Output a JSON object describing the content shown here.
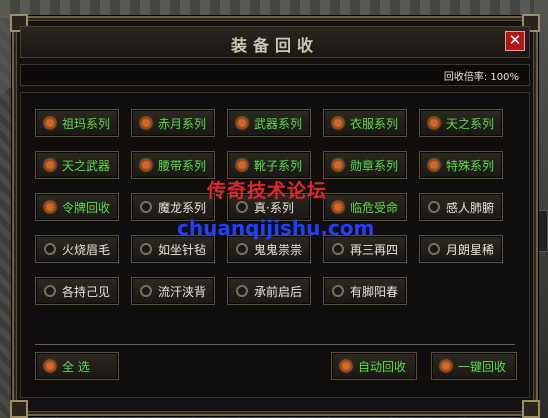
{
  "window": {
    "title": "装备回收",
    "rate_text": "回收倍率: 100%",
    "close_symbol": "✕"
  },
  "categories": [
    {
      "label": "祖玛系列",
      "checked": true
    },
    {
      "label": "赤月系列",
      "checked": true
    },
    {
      "label": "武器系列",
      "checked": true
    },
    {
      "label": "衣服系列",
      "checked": true
    },
    {
      "label": "天之系列",
      "checked": true
    },
    {
      "label": "天之武器",
      "checked": true
    },
    {
      "label": "腰带系列",
      "checked": true
    },
    {
      "label": "靴子系列",
      "checked": true
    },
    {
      "label": "勋章系列",
      "checked": true
    },
    {
      "label": "特殊系列",
      "checked": true
    },
    {
      "label": "令牌回收",
      "checked": true
    },
    {
      "label": "魔龙系列",
      "checked": false
    },
    {
      "label": "真·系列",
      "checked": false
    },
    {
      "label": "临危受命",
      "checked": true
    },
    {
      "label": "感人肺腑",
      "checked": false
    },
    {
      "label": "火烧眉毛",
      "checked": false
    },
    {
      "label": "如坐针毡",
      "checked": false
    },
    {
      "label": "鬼鬼祟祟",
      "checked": false
    },
    {
      "label": "再三再四",
      "checked": false
    },
    {
      "label": "月朗星稀",
      "checked": false
    },
    {
      "label": "各持己见",
      "checked": false
    },
    {
      "label": "流汗浃背",
      "checked": false
    },
    {
      "label": "承前启后",
      "checked": false
    },
    {
      "label": "有脚阳春",
      "checked": false
    }
  ],
  "footer": {
    "select_all": {
      "label": "全  选",
      "checked": true
    },
    "auto_recycle": {
      "label": "自动回收",
      "checked": true
    },
    "one_click_recycle": {
      "label": "一键回收",
      "checked": true
    }
  },
  "watermark": {
    "line1": "传奇技术论坛",
    "line2": "chuanqijishu.com"
  },
  "colors": {
    "checked_label": "#5cdc4a",
    "unchecked_label": "#e8e4dc",
    "close_bg": "#b01818",
    "watermark1": "#e02828",
    "watermark2": "#2040ff"
  }
}
